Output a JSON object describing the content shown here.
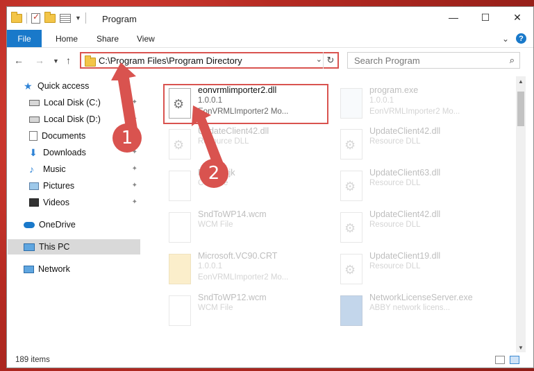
{
  "window": {
    "title": "Program"
  },
  "ribbon": {
    "file_tab": "File",
    "tabs": [
      "Home",
      "Share",
      "View"
    ],
    "help": "?"
  },
  "address": {
    "path": "C:\\Program Files\\Program Directory"
  },
  "search": {
    "placeholder": "Search Program"
  },
  "nav": {
    "items": [
      {
        "label": "Quick access",
        "icon": "star-icon",
        "pinned": false
      },
      {
        "label": "Local Disk (C:)",
        "icon": "disk-icon",
        "pinned": true
      },
      {
        "label": "Local Disk (D:)",
        "icon": "disk-icon",
        "pinned": true
      },
      {
        "label": "Documents",
        "icon": "documents-icon",
        "pinned": true
      },
      {
        "label": "Downloads",
        "icon": "downloads-icon",
        "pinned": true
      },
      {
        "label": "Music",
        "icon": "music-icon",
        "pinned": true
      },
      {
        "label": "Pictures",
        "icon": "pictures-icon",
        "pinned": true
      },
      {
        "label": "Videos",
        "icon": "videos-icon",
        "pinned": true
      },
      {
        "label": "OneDrive",
        "icon": "onedrive-icon",
        "pinned": false
      },
      {
        "label": "This PC",
        "icon": "this-pc-icon",
        "pinned": false,
        "selected": true
      },
      {
        "label": "Network",
        "icon": "network-icon",
        "pinned": false
      }
    ]
  },
  "files": [
    {
      "name": "eonvrmlimporter2.dll",
      "line2": "1.0.0.1",
      "line3": "EonVRMLImporter2 Mo...",
      "icon": "dll-file-icon",
      "highlighted": true
    },
    {
      "name": "program.exe",
      "line2": "1.0.0.1",
      "line3": "EonVRMLImporter2 Mo...",
      "icon": "exe-file-icon"
    },
    {
      "name": "UpdateClient42.dll",
      "line2": "Resource DLL",
      "icon": "dll-file-icon"
    },
    {
      "name": "UpdateClient42.dll",
      "line2": "Resource DLL",
      "icon": "dll-file-icon"
    },
    {
      "name": "Folder.cjk",
      "line2": "CJK File",
      "icon": "blank-file-icon"
    },
    {
      "name": "UpdateClient63.dll",
      "line2": "Resource DLL",
      "icon": "dll-file-icon"
    },
    {
      "name": "SndToWP14.wcm",
      "line2": "WCM File",
      "icon": "blank-file-icon"
    },
    {
      "name": "UpdateClient42.dll",
      "line2": "Resource DLL",
      "icon": "dll-file-icon"
    },
    {
      "name": "Microsoft.VC90.CRT",
      "line2": "1.0.0.1",
      "line3": "EonVRMLImporter2 Mo...",
      "icon": "folder-icon"
    },
    {
      "name": "UpdateClient19.dll",
      "line2": "Resource DLL",
      "icon": "dll-file-icon"
    },
    {
      "name": "SndToWP12.wcm",
      "line2": "WCM File",
      "icon": "blank-file-icon"
    },
    {
      "name": "NetworkLicenseServer.exe",
      "line2": "ABBY network licens...",
      "icon": "network-exe-icon"
    }
  ],
  "status": {
    "item_count": "189 items"
  },
  "annotations": {
    "step1": "1",
    "step2": "2"
  },
  "colors": {
    "accent": "#1979ca",
    "highlight": "#d9534f"
  }
}
